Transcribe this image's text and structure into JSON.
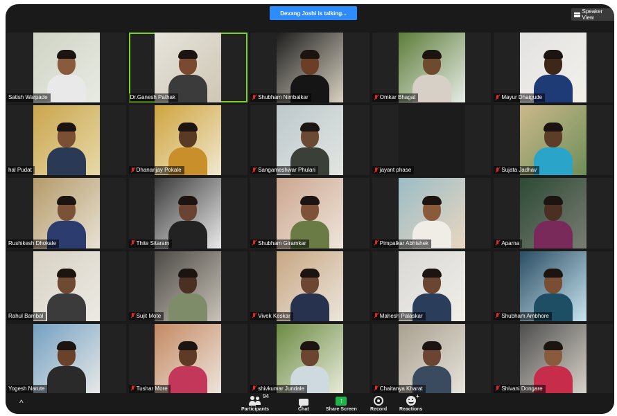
{
  "window": {
    "talking_banner": "Devang Joshi is talking...",
    "view_button": "Speaker View"
  },
  "participants": [
    {
      "name": "Satish Warpade",
      "muted": false
    },
    {
      "name": "Dr.Ganesh Pathak",
      "muted": false
    },
    {
      "name": "Shubham Nimbalkar",
      "muted": true
    },
    {
      "name": "Omkar Bhagat",
      "muted": true
    },
    {
      "name": "Mayur Dhaigude",
      "muted": true
    },
    {
      "name": "hal Pudat",
      "muted": false
    },
    {
      "name": "Dhananjay Pokale",
      "muted": true
    },
    {
      "name": "Sangameshwar Phulari",
      "muted": true
    },
    {
      "name": "jayant phase",
      "muted": true
    },
    {
      "name": "Sujata Jadhav",
      "muted": true
    },
    {
      "name": "Rushikesh Dhokale",
      "muted": false
    },
    {
      "name": "Thite Sitaram",
      "muted": true
    },
    {
      "name": "Shubham Giramkar",
      "muted": true
    },
    {
      "name": "Pimpalkar Abhishek",
      "muted": true
    },
    {
      "name": "Aparna",
      "muted": true
    },
    {
      "name": "Rahul Bambal",
      "muted": false
    },
    {
      "name": "Sujit Mote",
      "muted": true
    },
    {
      "name": "Vivek Keskar",
      "muted": true
    },
    {
      "name": "Mahesh Palaskar",
      "muted": true
    },
    {
      "name": "Shubham Ambhore",
      "muted": true
    },
    {
      "name": "Yogesh Narute",
      "muted": false
    },
    {
      "name": "Tushar More",
      "muted": true
    },
    {
      "name": "shivkumar Jundale",
      "muted": true
    },
    {
      "name": "Chaitanya Kharat",
      "muted": true
    },
    {
      "name": "Shivani Dongare",
      "muted": true
    }
  ],
  "toolbar": {
    "participants_label": "Participants",
    "participants_count": "94",
    "chat_label": "Chat",
    "share_label": "Share Screen",
    "record_label": "Record",
    "reactions_label": "Reactions"
  },
  "colors": {
    "talking_banner": "#2d8cff",
    "active_speaker_border": "#7ed321",
    "muted_mic": "#e02828",
    "share_screen": "#21b24b"
  }
}
